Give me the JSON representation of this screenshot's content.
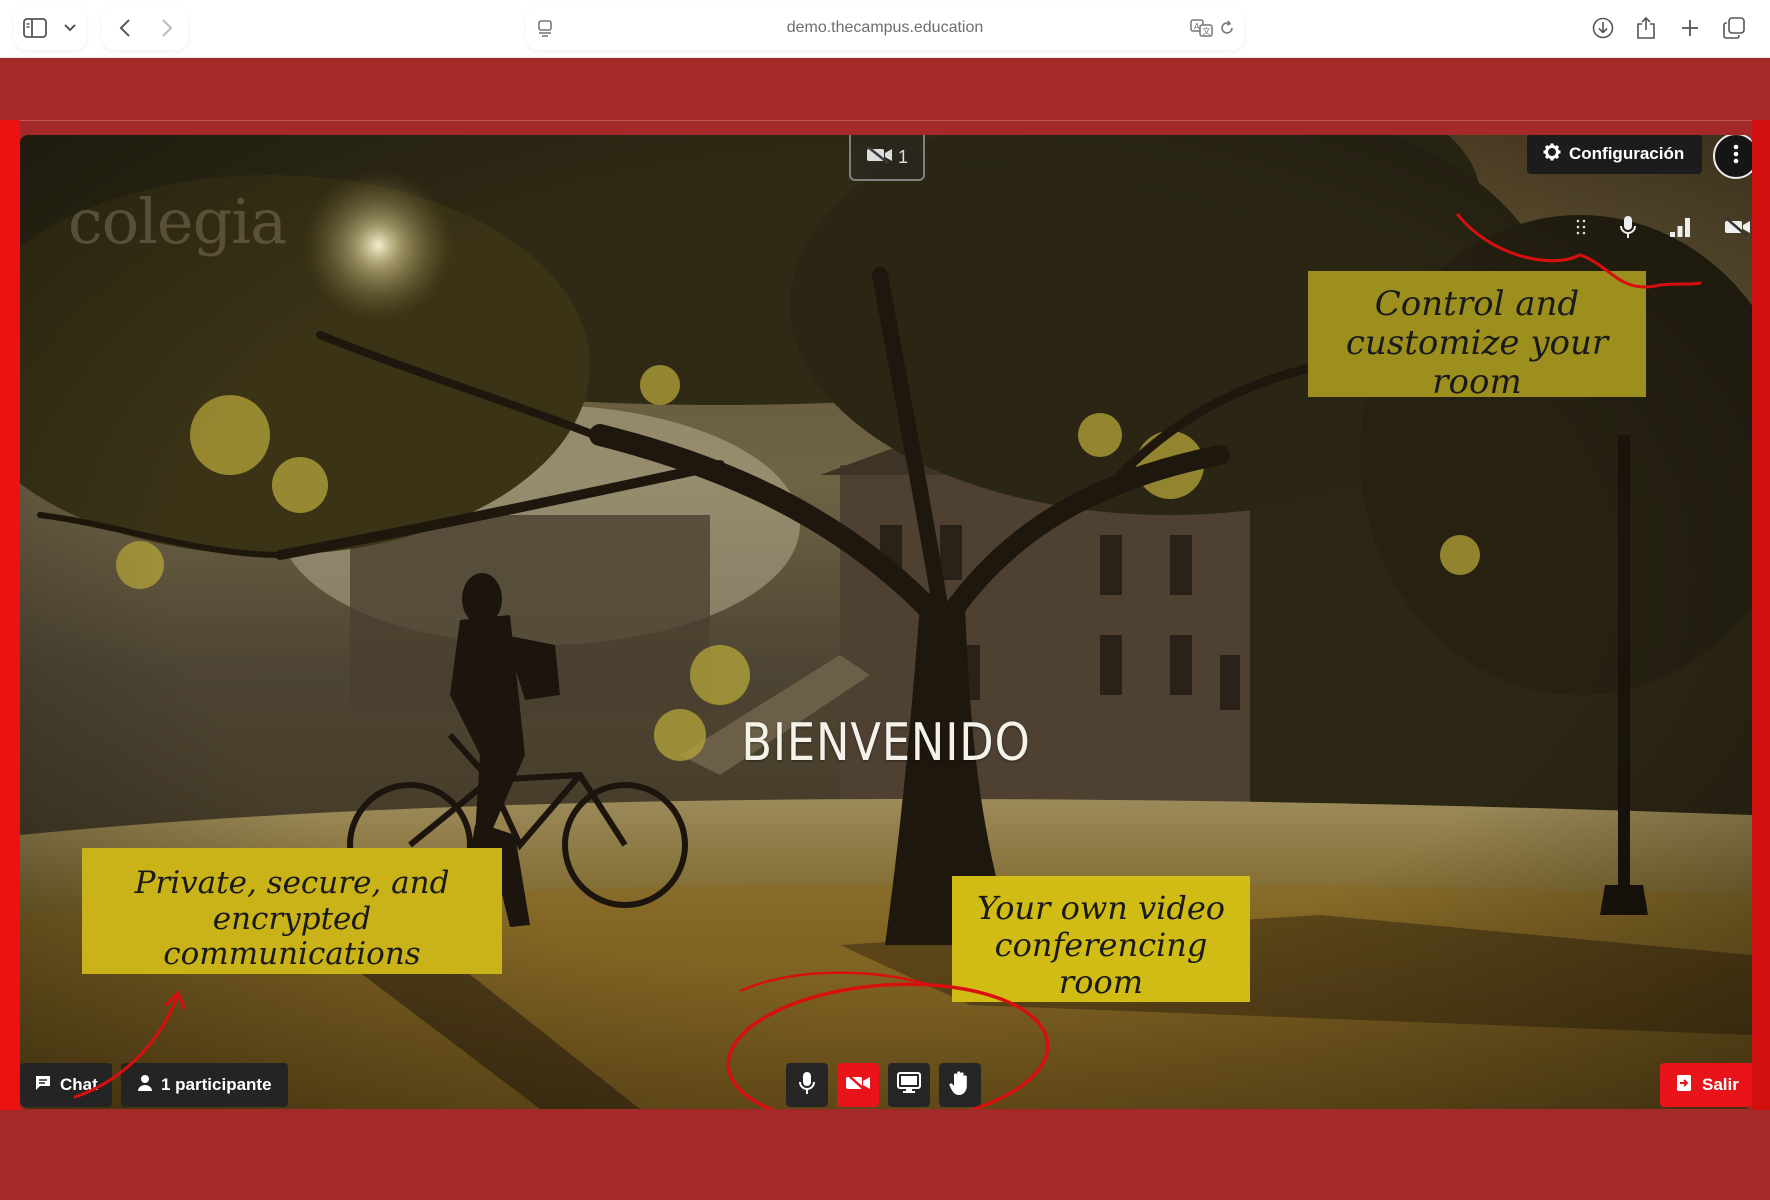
{
  "browser": {
    "url": "demo.thecampus.education"
  },
  "room": {
    "welcome_text": "BIENVENIDO",
    "logo_text": "colegia",
    "camera_count": "1",
    "config_label": "Configuración"
  },
  "bottom_bar": {
    "chat_label": "Chat",
    "participants_label": "1 participante",
    "leave_label": "Salir"
  },
  "annotations": {
    "note_top_right_line1": "Control and",
    "note_top_right_line2": "customize your room",
    "note_left_line1": "Private, secure, and",
    "note_left_line2": "encrypted communications",
    "note_center_line1": "Your own video",
    "note_center_line2": "conferencing room"
  },
  "colors": {
    "page_bg": "#a42a2a",
    "accent_red": "#e8141a",
    "note_yellow": "#d1bb15",
    "control_bg": "#262626"
  },
  "icons": {
    "toolbar": [
      "sidebar-icon",
      "chevron-down-icon",
      "back-icon",
      "forward-icon",
      "reader-icon",
      "translate-icon",
      "reload-icon",
      "download-icon",
      "share-icon",
      "new-tab-icon",
      "tabs-icon"
    ],
    "controls": [
      "microphone-icon",
      "camera-off-icon",
      "screen-share-icon",
      "raise-hand-icon"
    ]
  }
}
